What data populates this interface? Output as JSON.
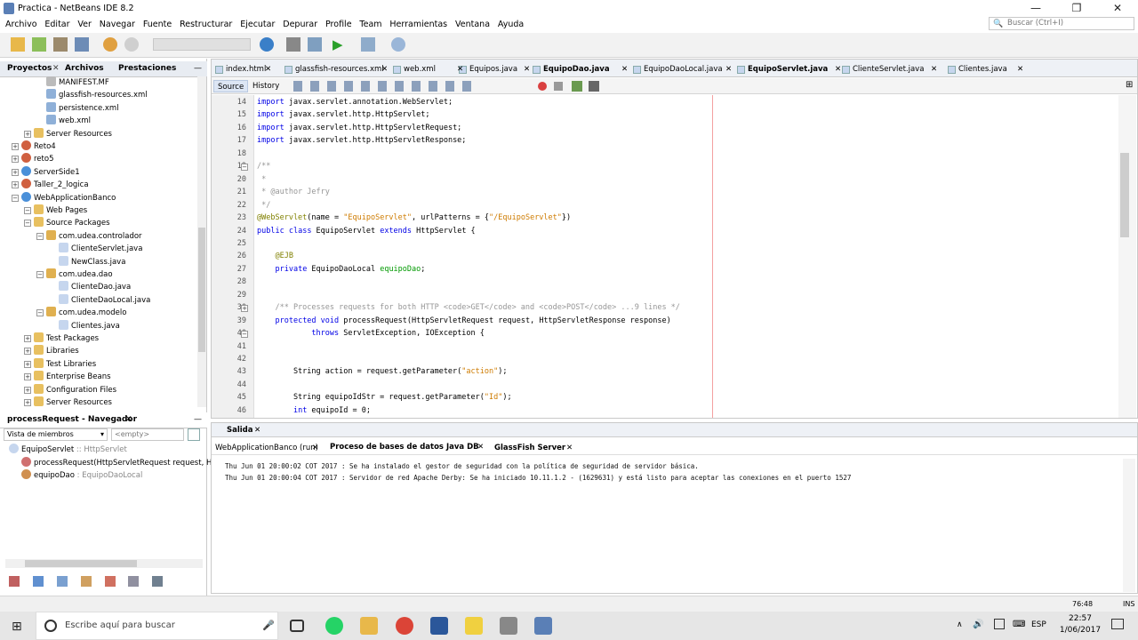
{
  "window": {
    "title": "Practica - NetBeans IDE 8.2",
    "minimize": "—",
    "maximize": "❐",
    "close": "✕"
  },
  "menu": [
    "Archivo",
    "Editar",
    "Ver",
    "Navegar",
    "Fuente",
    "Restructurar",
    "Ejecutar",
    "Depurar",
    "Profile",
    "Team",
    "Herramientas",
    "Ventana",
    "Ayuda"
  ],
  "search": {
    "placeholder": "Buscar (Ctrl+I)"
  },
  "projects_panel": {
    "tabs": [
      "Proyectos",
      "Archivos",
      "Prestaciones"
    ]
  },
  "tree": [
    {
      "label": "MANIFEST.MF",
      "depth": 3,
      "icon": "file"
    },
    {
      "label": "glassfish-resources.xml",
      "depth": 3,
      "icon": "xml"
    },
    {
      "label": "persistence.xml",
      "depth": 3,
      "icon": "xml"
    },
    {
      "label": "web.xml",
      "depth": 3,
      "icon": "xml"
    },
    {
      "label": "Server Resources",
      "depth": 2,
      "icon": "folder"
    },
    {
      "label": "Reto4",
      "depth": 1,
      "icon": "project"
    },
    {
      "label": "reto5",
      "depth": 1,
      "icon": "project"
    },
    {
      "label": "ServerSide1",
      "depth": 1,
      "icon": "web"
    },
    {
      "label": "Taller_2_logica",
      "depth": 1,
      "icon": "project"
    },
    {
      "label": "WebApplicationBanco",
      "depth": 1,
      "icon": "web"
    },
    {
      "label": "Web Pages",
      "depth": 2,
      "icon": "folder"
    },
    {
      "label": "Source Packages",
      "depth": 2,
      "icon": "folder"
    },
    {
      "label": "com.udea.controlador",
      "depth": 3,
      "icon": "package"
    },
    {
      "label": "ClienteServlet.java",
      "depth": 4,
      "icon": "java"
    },
    {
      "label": "NewClass.java",
      "depth": 4,
      "icon": "java"
    },
    {
      "label": "com.udea.dao",
      "depth": 3,
      "icon": "package"
    },
    {
      "label": "ClienteDao.java",
      "depth": 4,
      "icon": "java"
    },
    {
      "label": "ClienteDaoLocal.java",
      "depth": 4,
      "icon": "java"
    },
    {
      "label": "com.udea.modelo",
      "depth": 3,
      "icon": "package"
    },
    {
      "label": "Clientes.java",
      "depth": 4,
      "icon": "java"
    },
    {
      "label": "Test Packages",
      "depth": 2,
      "icon": "folder"
    },
    {
      "label": "Libraries",
      "depth": 2,
      "icon": "folder"
    },
    {
      "label": "Test Libraries",
      "depth": 2,
      "icon": "folder"
    },
    {
      "label": "Enterprise Beans",
      "depth": 2,
      "icon": "folder"
    },
    {
      "label": "Configuration Files",
      "depth": 2,
      "icon": "folder"
    },
    {
      "label": "Server Resources",
      "depth": 2,
      "icon": "folder"
    }
  ],
  "navigator": {
    "title": "processRequest - Navegador",
    "view_label": "Vista de miembros",
    "filter": "<empty>",
    "items": [
      {
        "name": "EquipoServlet",
        "type": " :: HttpServlet"
      },
      {
        "name": "processRequest(HttpServletRequest request, HttpS",
        "type": ""
      },
      {
        "name": "equipoDao",
        "type": " : EquipoDaoLocal"
      }
    ]
  },
  "editor_tabs": [
    "index.html",
    "glassfish-resources.xml",
    "web.xml",
    "Equipos.java",
    "EquipoDao.java",
    "EquipoDaoLocal.java",
    "EquipoServlet.java",
    "ClienteServlet.java",
    "Clientes.java"
  ],
  "editor_toolbar": {
    "source": "Source",
    "history": "History"
  },
  "code": [
    {
      "n": "14",
      "t": "import javax.servlet.annotation.WebServlet;"
    },
    {
      "n": "15",
      "t": "import javax.servlet.http.HttpServlet;"
    },
    {
      "n": "16",
      "t": "import javax.servlet.http.HttpServletRequest;"
    },
    {
      "n": "17",
      "t": "import javax.servlet.http.HttpServletResponse;"
    },
    {
      "n": "18",
      "t": ""
    },
    {
      "n": "19",
      "t": "/**"
    },
    {
      "n": "20",
      "t": " *"
    },
    {
      "n": "21",
      "t": " * @author Jefry"
    },
    {
      "n": "22",
      "t": " */"
    },
    {
      "n": "23",
      "t": "@WebServlet(name = \"EquipoServlet\", urlPatterns = {\"/EquipoServlet\"})"
    },
    {
      "n": "24",
      "t": "public class EquipoServlet extends HttpServlet {"
    },
    {
      "n": "25",
      "t": ""
    },
    {
      "n": "26",
      "t": "    @EJB"
    },
    {
      "n": "27",
      "t": "    private EquipoDaoLocal equipoDao;"
    },
    {
      "n": "28",
      "t": ""
    },
    {
      "n": "29",
      "t": ""
    },
    {
      "n": "30",
      "t": "    /** Processes requests for both HTTP <code>GET</code> and <code>POST</code> ...9 lines */"
    },
    {
      "n": "39",
      "t": "    protected void processRequest(HttpServletRequest request, HttpServletResponse response)"
    },
    {
      "n": "40",
      "t": "            throws ServletException, IOException {"
    },
    {
      "n": "41",
      "t": ""
    },
    {
      "n": "42",
      "t": ""
    },
    {
      "n": "43",
      "t": "        String action = request.getParameter(\"action\");"
    },
    {
      "n": "44",
      "t": ""
    },
    {
      "n": "45",
      "t": "        String equipoIdStr = request.getParameter(\"Id\");"
    },
    {
      "n": "46",
      "t": "        int equipoId = 0;"
    }
  ],
  "output": {
    "title": "Salida",
    "tabs": [
      "WebApplicationBanco (run)",
      "Proceso de bases de datos Java DB",
      "GlassFish Server"
    ],
    "lines": [
      "Thu Jun 01 20:00:02 COT 2017 : Se ha instalado el gestor de seguridad con la política de seguridad de servidor básica.",
      "Thu Jun 01 20:00:04 COT 2017 : Servidor de red Apache Derby: Se ha iniciado 10.11.1.2 - (1629631) y está listo para aceptar las conexiones en el puerto 1527"
    ]
  },
  "status": {
    "position": "76:48",
    "mode": "INS"
  },
  "taskbar": {
    "search": "Escribe aquí para buscar",
    "lang": "ESP",
    "time": "22:57",
    "date": "1/06/2017"
  },
  "colors": {
    "keyword": "#0000e6",
    "string": "#ce7b00",
    "comment": "#969696",
    "field": "#009900"
  }
}
